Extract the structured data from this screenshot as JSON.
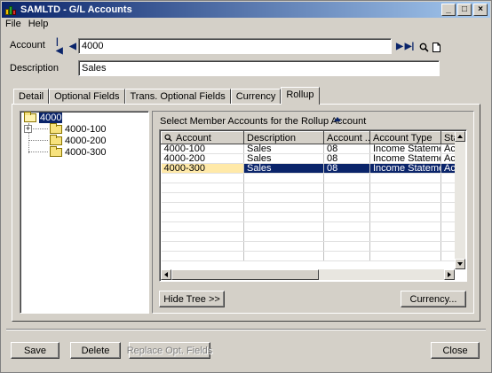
{
  "window": {
    "title": "SAMLTD - G/L Accounts"
  },
  "titlebar_buttons": {
    "minimize": "_",
    "maximize": "□",
    "close": "×"
  },
  "menu": [
    "File",
    "Help"
  ],
  "account": {
    "label": "Account",
    "value": "4000"
  },
  "description": {
    "label": "Description",
    "value": "Sales"
  },
  "tabs": [
    "Detail",
    "Optional Fields",
    "Trans. Optional Fields",
    "Currency",
    "Rollup"
  ],
  "active_tab": "Rollup",
  "tree": {
    "root": "4000",
    "children": [
      "4000-100",
      "4000-200",
      "4000-300"
    ]
  },
  "rollup": {
    "title": "Select Member Accounts for the Rollup Account",
    "columns": [
      "Account",
      "Description",
      "Account ...",
      "Account Type",
      "Sta"
    ],
    "rows": [
      [
        "4000-100",
        "Sales",
        "08",
        "Income Statement",
        "Act"
      ],
      [
        "4000-200",
        "Sales",
        "08",
        "Income Statement",
        "Act"
      ],
      [
        "4000-300",
        "Sales",
        "08",
        "Income Statement",
        "Act"
      ]
    ],
    "selected_row": 2,
    "hide_tree_label": "Hide Tree >>",
    "currency_label": "Currency..."
  },
  "footer": {
    "save": "Save",
    "delete": "Delete",
    "replace_opt_fields": "Replace Opt. Fields",
    "close": "Close"
  }
}
